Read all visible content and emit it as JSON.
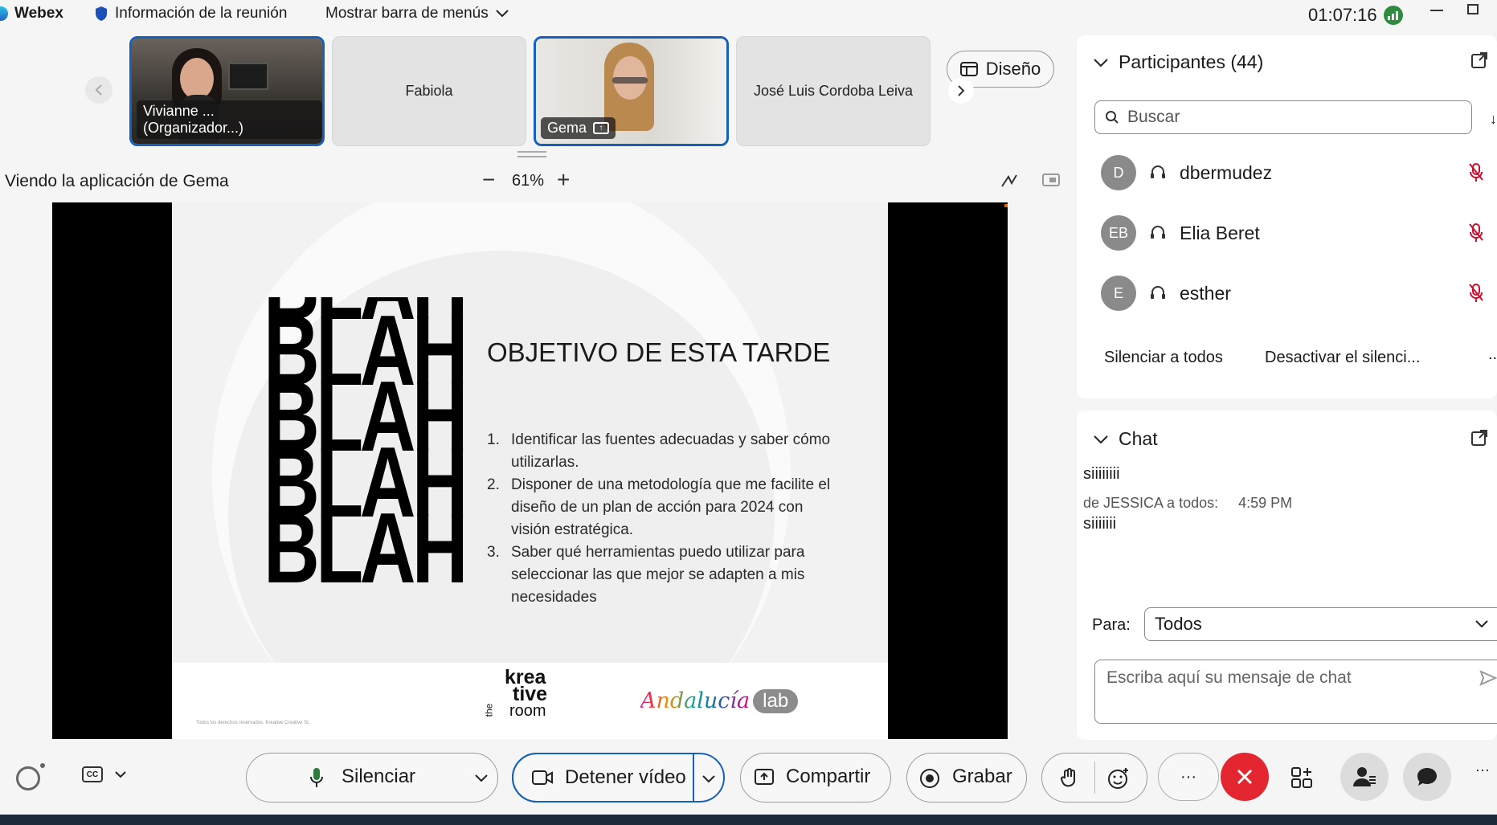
{
  "app": {
    "name": "Webex",
    "meeting_info": "Información de la reunión",
    "menu_bar": "Mostrar barra de menús",
    "clock": "01:07:16"
  },
  "video_strip": {
    "tiles": [
      {
        "name": "Vivianne ... (Organizador...)"
      },
      {
        "name": "Fabiola"
      },
      {
        "name": "Gema"
      },
      {
        "name": "José Luis Cordoba Leiva"
      }
    ],
    "layout_button": "Diseño"
  },
  "share": {
    "viewing_label": "Viendo la aplicación de Gema",
    "zoom": "61%",
    "zoom_out": "−",
    "zoom_in": "+"
  },
  "slide": {
    "blah_lines": [
      "BLAH",
      "BLAH",
      "BLAH",
      "BLAH"
    ],
    "title": "OBJETIVO DE ESTA TARDE",
    "items": [
      {
        "num": "1.",
        "lines": [
          "Identificar las fuentes adecuadas y saber cómo",
          "utilizarlas."
        ]
      },
      {
        "num": "2.",
        "lines": [
          "Disponer de una metodología que me facilite el",
          "diseño de un plan de acción para 2024 con",
          "visión estratégica."
        ]
      },
      {
        "num": "3.",
        "lines": [
          "Saber qué herramientas puedo utilizar para",
          "seleccionar las que mejor se adapten a mis",
          "necesidades"
        ]
      }
    ],
    "logo_krea": [
      "krea",
      "tive",
      "room"
    ],
    "logo_the": "the",
    "logo_andalucia": "Andalucía",
    "logo_lab": "lab",
    "footer_note": "Todos los derechos reservados. Kreative Creative SL"
  },
  "participants": {
    "title": "Participantes (44)",
    "search_placeholder": "Buscar",
    "list": [
      {
        "initials": "D",
        "name": "dbermudez"
      },
      {
        "initials": "EB",
        "name": "Elia Beret"
      },
      {
        "initials": "E",
        "name": "esther"
      }
    ],
    "mute_all": "Silenciar a todos",
    "unmute_all": "Desactivar el silenci...",
    "more": "..."
  },
  "chat": {
    "title": "Chat",
    "messages": [
      {
        "sender": "",
        "time": "",
        "text": "siiiiiiii"
      },
      {
        "sender": "de JESSICA a todos:",
        "time": "4:59 PM",
        "text": "siiiiiii"
      }
    ],
    "to_label": "Para:",
    "to_value": "Todos",
    "input_placeholder": "Escriba aquí su mensaje de chat"
  },
  "controls": {
    "mute": "Silenciar",
    "stop_video": "Detener vídeo",
    "share": "Compartir",
    "record": "Grabar",
    "more": "···"
  },
  "colors": {
    "accent": "#1560b8",
    "end_call": "#e3262f",
    "mute_red": "#c8102e"
  }
}
